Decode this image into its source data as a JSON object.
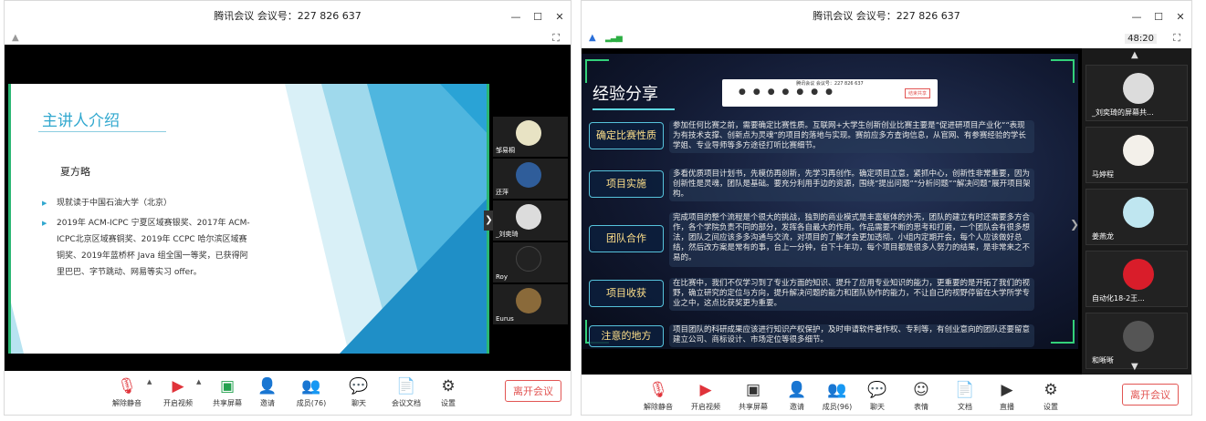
{
  "left": {
    "title": "腾讯会议 会议号：227 826 637",
    "window_controls": [
      "—",
      "☐",
      "✕"
    ],
    "icons": {
      "shield": "shield-icon",
      "fullscreen": "fullscreen-icon"
    },
    "slide": {
      "heading": "主讲人介绍",
      "name": "夏方略",
      "bullets": [
        "现就读于中国石油大学（北京）",
        "2019年 ACM-ICPC 宁夏区域赛银奖、2017年 ACM-ICPC北京区域赛铜奖、2019年 CCPC 哈尔滨区域赛铜奖、2019年蓝桥杯 Java 组全国一等奖，已获得阿里巴巴、字节跳动、网易等实习 offer。"
      ]
    },
    "participants": [
      {
        "name": "邹易桐",
        "color": "#e8e3c4"
      },
      {
        "name": "还萍",
        "color": "#2f5d9a"
      },
      {
        "name": "_刘奕琦",
        "color": "#dcdcdc"
      },
      {
        "name": "Roy",
        "color": "#222222"
      },
      {
        "name": "Eurus",
        "color": "#8a6a3a"
      }
    ],
    "toolbar": [
      {
        "label": "解除静音",
        "icon": "mic-off-icon",
        "glyph": "🎙",
        "red": true
      },
      {
        "label": "开启视频",
        "icon": "camera-off-icon",
        "glyph": "▶",
        "red": true
      },
      {
        "label": "共享屏幕",
        "icon": "share-screen-icon",
        "glyph": "▣",
        "green": true
      },
      {
        "label": "邀请",
        "icon": "invite-icon",
        "glyph": "👤"
      },
      {
        "label": "成员(76)",
        "icon": "members-icon",
        "glyph": "👥"
      },
      {
        "label": "聊天",
        "icon": "chat-icon",
        "glyph": "💬"
      },
      {
        "label": "会议文档",
        "icon": "document-icon",
        "glyph": "📄"
      },
      {
        "label": "设置",
        "icon": "settings-icon",
        "glyph": "⚙"
      }
    ],
    "leave": "离开会议"
  },
  "right": {
    "title": "腾讯会议 会议号：227 826 637",
    "window_controls": [
      "—",
      "☐",
      "✕"
    ],
    "timer": "48:20",
    "slide": {
      "heading": "经验分享",
      "rows": [
        {
          "label": "确定比赛性质",
          "text": "参加任何比赛之前，需要确定比赛性质。互联网+大学生创新创业比赛主要是“促进研项目产业化”“表现为有技术支撑、创新点为灵魂”的项目的落地与实现。赛前应多方查询信息，从官网、有参赛经验的学长学姐、专业导师等多方途径打听比赛细节。"
        },
        {
          "label": "项目实施",
          "text": "多看优质项目计划书，先模仿再创新，先学习再创作。确定项目立意，紧抓中心，创新性非常重要，因为创新性是灵魂，团队是基础。要充分利用手边的资源，围绕“提出问题”“分析问题”“解决问题”展开项目架构。"
        },
        {
          "label": "团队合作",
          "text": "完成项目的整个流程是个很大的挑战，独到的商业模式是丰富躯体的外壳，团队的建立有时还需要多方合作，各个学院负责不同的部分，发挥各自最大的作用。作品需要不断的思考和打磨，一个团队会有很多想法，团队之间应该多多沟通与交流，对项目的了解才会更加透彻。小组内定期开会，每个人应该做好总结，然后改方案是常有的事，台上一分钟，台下十年功，每个项目都是很多人努力的结果，是非常来之不易的。"
        },
        {
          "label": "项目收获",
          "text": "在比赛中，我们不仅学习到了专业方面的知识、提升了应用专业知识的能力，更重要的是开拓了我们的视野，确立研究的定位与方向，提升解决问题的能力和团队协作的能力，不让自己的视野停留在大学所学专业之中，这点比获奖更为重要。"
        },
        {
          "label": "注意的地方",
          "text": "项目团队的科研成果应该进行知识产权保护，及时申请软件著作权、专利等，有创业意向的团队还要留意建立公司、商标设计、市场定位等很多细节。"
        }
      ],
      "mini_title": "腾讯会议 会议号：227 826 637",
      "mini_leave": "结束共享"
    },
    "participants": [
      {
        "name": "_刘奕琦的屏幕共...",
        "color": "#dcdcdc"
      },
      {
        "name": "马婷程",
        "color": "#f3f0ea"
      },
      {
        "name": "姜燕龙",
        "color": "#bfe6f0"
      },
      {
        "name": "自动化18-2王...",
        "color": "#d91d2a"
      },
      {
        "name": "和晰晰",
        "color": "#555555"
      }
    ],
    "toolbar": [
      {
        "label": "解除静音",
        "icon": "mic-off-icon",
        "glyph": "🎙",
        "red": true
      },
      {
        "label": "开启视频",
        "icon": "camera-off-icon",
        "glyph": "▶",
        "red": true
      },
      {
        "label": "共享屏幕",
        "icon": "share-screen-icon",
        "glyph": "▣"
      },
      {
        "label": "邀请",
        "icon": "invite-icon",
        "glyph": "👤"
      },
      {
        "label": "成员(96)",
        "icon": "members-icon",
        "glyph": "👥"
      },
      {
        "label": "聊天",
        "icon": "chat-icon",
        "glyph": "💬"
      },
      {
        "label": "表情",
        "icon": "emoji-icon",
        "glyph": "☺"
      },
      {
        "label": "文档",
        "icon": "document-icon",
        "glyph": "📄"
      },
      {
        "label": "直播",
        "icon": "live-icon",
        "glyph": "▶"
      },
      {
        "label": "设置",
        "icon": "settings-icon",
        "glyph": "⚙"
      }
    ],
    "leave": "离开会议"
  }
}
